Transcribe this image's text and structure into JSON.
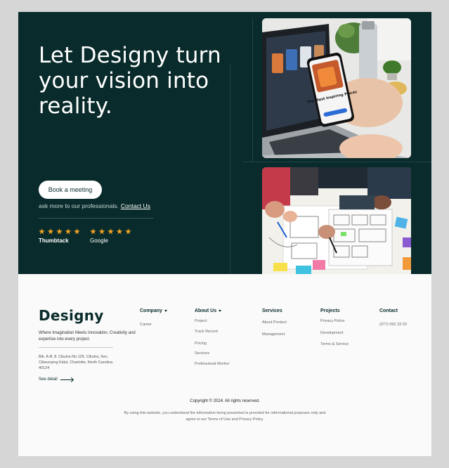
{
  "hero": {
    "title": "Let Designy turn your vision into reality.",
    "cta_label": "Book a meeting",
    "ask_text": "ask more to our professionals.",
    "contact_link": "Contact Us",
    "ratings": [
      {
        "source": "Thumbtack",
        "stars": 5
      },
      {
        "source": "Google",
        "stars": 5
      }
    ],
    "colors": {
      "background": "#0a2b2b",
      "star": "#f5a623"
    }
  },
  "photos": {
    "top": {
      "caption": "The Most Inspiring Places",
      "icon": "phone-laptop-photo"
    },
    "bottom": {
      "icon": "wireframe-sketching-photo"
    }
  },
  "footer": {
    "logo": "Designy",
    "tagline": "Where Imagination Meets Innovation. Creativity and expertise into every project.",
    "address": "Blk. A-B Jl. Cikutra No.125, Cikutra, Kec. Cibeunying Kidul, Charlotte, North Carolina 40124",
    "see_detail": "See detail",
    "columns": {
      "company": {
        "title": "Company",
        "links": [
          "Career"
        ]
      },
      "about": {
        "title": "About Us",
        "links": [
          "Project",
          "Track Record",
          "Pricing",
          "Services",
          "Professional Worker"
        ]
      },
      "services": {
        "title": "Services",
        "links": [
          "About Product",
          "Management"
        ]
      },
      "projects": {
        "title": "Projects",
        "links": [
          "Privacy Police",
          "Development",
          "Terms & Service"
        ]
      },
      "contact": {
        "title": "Contact",
        "links": [
          "(077) 092 33 53"
        ]
      }
    },
    "copyright": "Copyright © 2024. All rights reserved.",
    "disclaimer": "By using this website, you understand the information being presented is provided for informational purposes only and agree to our Terms of Use and Privacy Policy."
  }
}
